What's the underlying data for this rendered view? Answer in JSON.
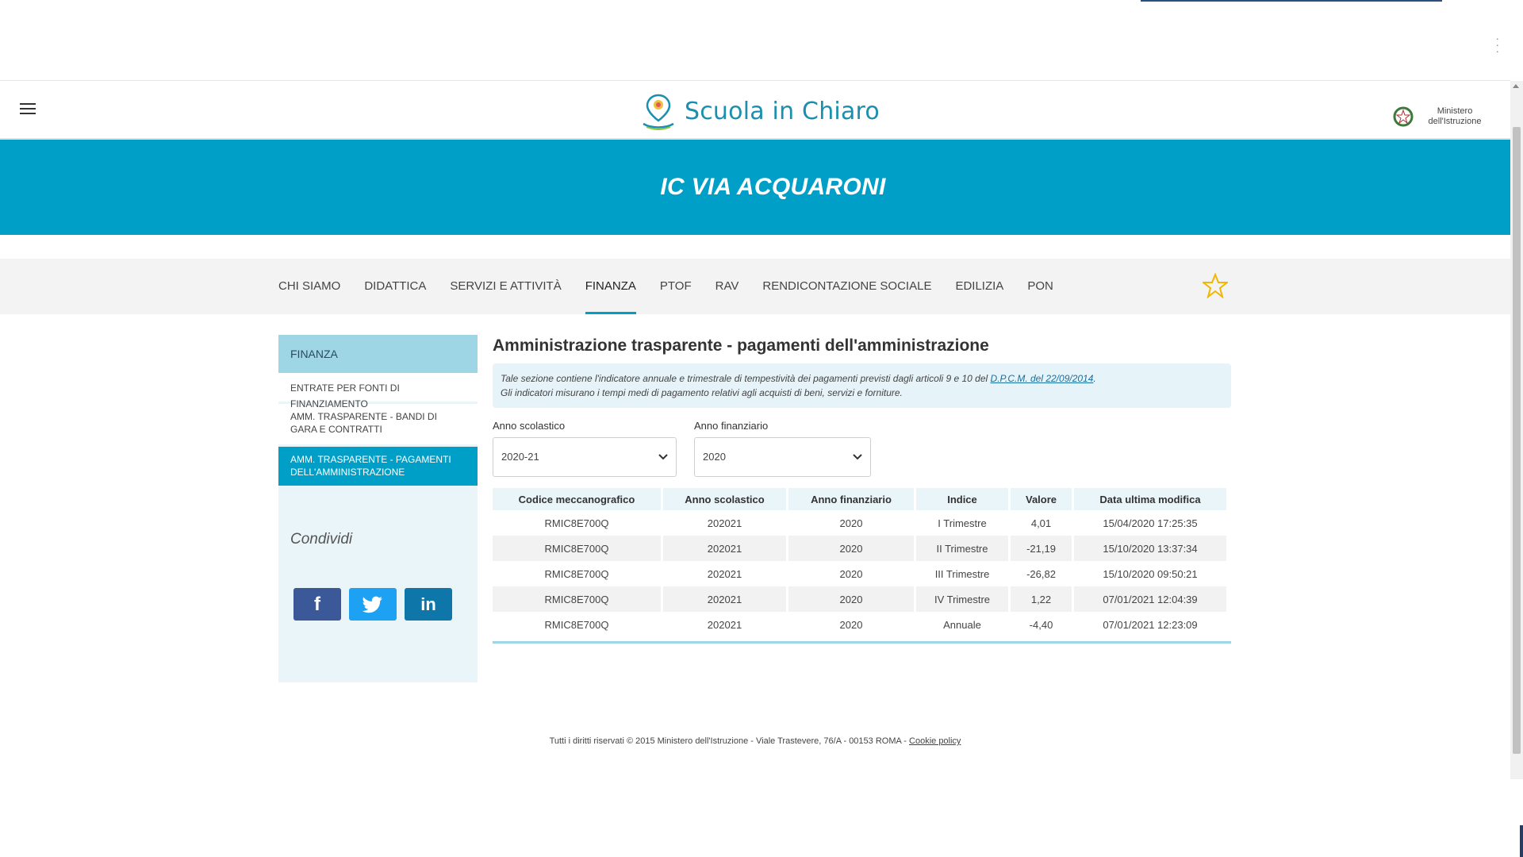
{
  "header": {
    "logo_text": "Scuola in Chiaro",
    "ministero": "Ministero dell'Istruzione"
  },
  "banner": {
    "title": "IC VIA ACQUARONI"
  },
  "nav": {
    "items": [
      "CHI SIAMO",
      "DIDATTICA",
      "SERVIZI E ATTIVITÀ",
      "FINANZA",
      "PTOF",
      "RAV",
      "RENDICONTAZIONE SOCIALE",
      "EDILIZIA",
      "PON"
    ],
    "active": "FINANZA"
  },
  "sidebar": {
    "heading": "FINANZA",
    "items": [
      "ENTRATE PER FONTI DI FINANZIAMENTO",
      "AMM. TRASPARENTE - BANDI DI GARA E CONTRATTI",
      "AMM. TRASPARENTE - PAGAMENTI DELL'AMMINISTRAZIONE"
    ],
    "share_label": "Condividi",
    "social": [
      "facebook-icon",
      "twitter-icon",
      "linkedin-icon"
    ]
  },
  "main": {
    "title": "Amministrazione trasparente - pagamenti dell'amministrazione",
    "info_line1": "Tale sezione contiene l'indicatore annuale e trimestrale di tempestività dei pagamenti previsti dagli articoli 9 e 10 del ",
    "info_link": "D.P.C.M. del 22/09/2014",
    "info_line1_end": ".",
    "info_line2": "Gli indicatori misurano i tempi medi di pagamento relativi agli acquisti di beni, servizi e forniture.",
    "filters": {
      "anno_scolastico_label": "Anno scolastico",
      "anno_scolastico_value": "2020-21",
      "anno_finanziario_label": "Anno finanziario",
      "anno_finanziario_value": "2020"
    },
    "table": {
      "headers": [
        "Codice meccanografico",
        "Anno scolastico",
        "Anno finanziario",
        "Indice",
        "Valore",
        "Data ultima modifica"
      ],
      "rows": [
        [
          "RMIC8E700Q",
          "202021",
          "2020",
          "I Trimestre",
          "4,01",
          "15/04/2020 17:25:35"
        ],
        [
          "RMIC8E700Q",
          "202021",
          "2020",
          "II Trimestre",
          "-21,19",
          "15/10/2020 13:37:34"
        ],
        [
          "RMIC8E700Q",
          "202021",
          "2020",
          "III Trimestre",
          "-26,82",
          "15/10/2020 09:50:21"
        ],
        [
          "RMIC8E700Q",
          "202021",
          "2020",
          "IV Trimestre",
          "1,22",
          "07/01/2021 12:04:39"
        ],
        [
          "RMIC8E700Q",
          "202021",
          "2020",
          "Annuale",
          "-4,40",
          "07/01/2021 12:23:09"
        ]
      ]
    }
  },
  "footer": {
    "text": "Tutti i diritti riservati © 2015 Ministero dell'Istruzione - Viale Trastevere, 76/A - 00153 ROMA - ",
    "link": "Cookie policy"
  },
  "colors": {
    "accent": "#009fc7",
    "sidebar_bg": "#eaf5f9",
    "sidebar_head": "#9fd6e6"
  }
}
